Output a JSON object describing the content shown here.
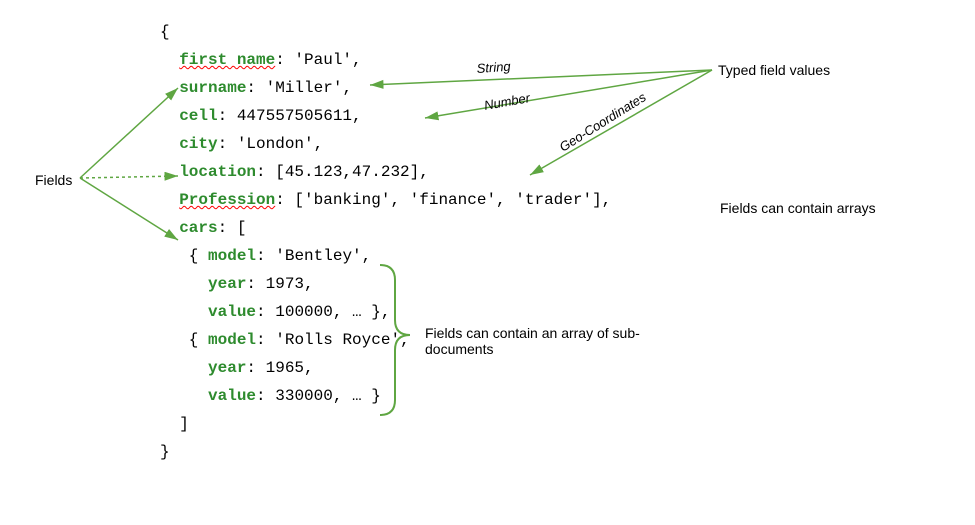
{
  "fields": {
    "first_name_key": "first name",
    "first_name_val": "'Paul'",
    "surname_key": "surname",
    "surname_val": "'Miller'",
    "cell_key": "cell",
    "cell_val": "447557505611",
    "city_key": "city",
    "city_val": "'London'",
    "location_key": "location",
    "location_val": "[45.123,47.232]",
    "profession_key": "Profession",
    "profession_val": "['banking', 'finance', 'trader']",
    "cars_key": "cars",
    "car1_model_key": "model",
    "car1_model_val": "'Bentley'",
    "car1_year_key": "year",
    "car1_year_val": "1973",
    "car1_value_key": "value",
    "car1_value_val": "100000",
    "car2_model_key": "model",
    "car2_model_val": "'Rolls Royce'",
    "car2_year_key": "year",
    "car2_year_val": "1965",
    "car2_value_key": "value",
    "car2_value_val": "330000"
  },
  "labels": {
    "fields": "Fields",
    "typed": "Typed field values",
    "arrays": "Fields can contain arrays",
    "subdocs": "Fields can contain an array of sub-documents",
    "string": "String",
    "number": "Number",
    "geo": "Geo-Coordinates"
  }
}
